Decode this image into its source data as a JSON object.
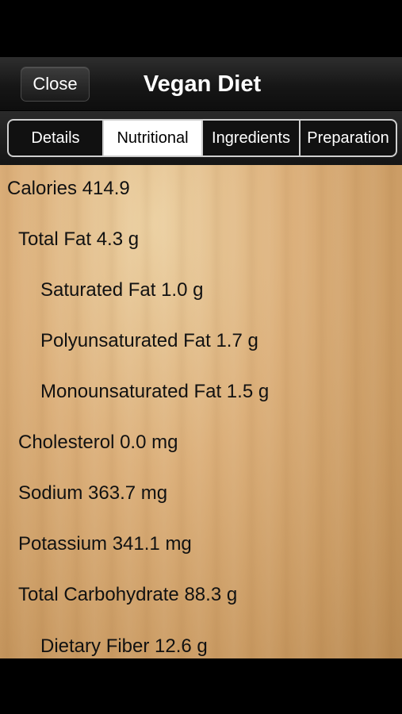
{
  "nav": {
    "close_label": "Close",
    "title": "Vegan Diet"
  },
  "tabs": [
    {
      "label": "Details",
      "selected": false
    },
    {
      "label": "Nutritional",
      "selected": true
    },
    {
      "label": "Ingredients",
      "selected": false
    },
    {
      "label": "Preparation",
      "selected": false
    }
  ],
  "nutrition": [
    {
      "label": "Calories 414.9",
      "level": 0
    },
    {
      "label": "Total Fat 4.3 g",
      "level": 1
    },
    {
      "label": "Saturated Fat 1.0 g",
      "level": 2
    },
    {
      "label": "Polyunsaturated Fat 1.7 g",
      "level": 2
    },
    {
      "label": "Monounsaturated Fat 1.5 g",
      "level": 2
    },
    {
      "label": "Cholesterol 0.0 mg",
      "level": 1
    },
    {
      "label": "Sodium 363.7 mg",
      "level": 1
    },
    {
      "label": "Potassium 341.1 mg",
      "level": 1
    },
    {
      "label": "Total Carbohydrate 88.3 g",
      "level": 1
    },
    {
      "label": "Dietary Fiber 12.6 g",
      "level": 2
    }
  ],
  "colors": {
    "selected_tab_bg": "#ffffff",
    "nav_bg": "#161616",
    "wood": "#d8ac76"
  }
}
